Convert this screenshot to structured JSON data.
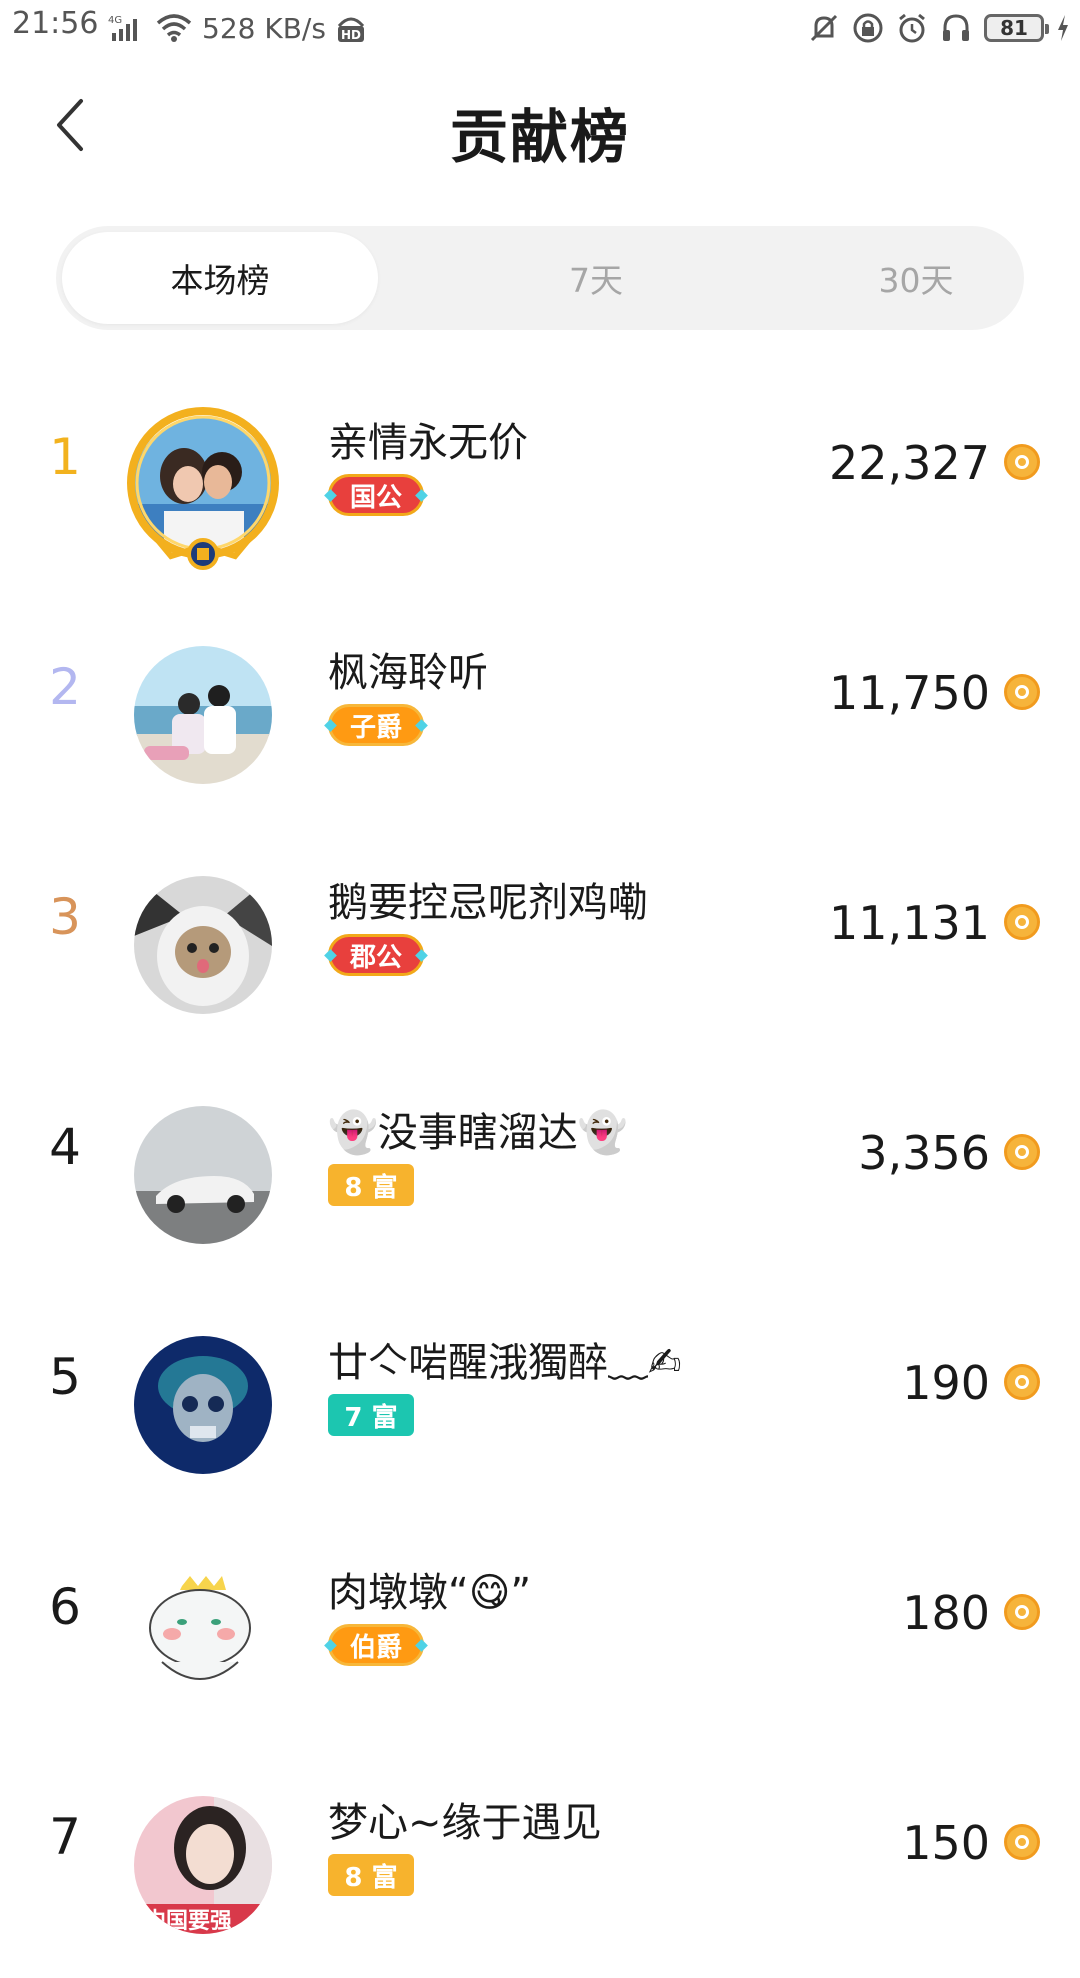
{
  "status_bar": {
    "time": "21:56",
    "network": "4G",
    "speed": "528 KB/s",
    "battery": "81",
    "icons": [
      "signal-icon",
      "wifi-icon",
      "hd-icon",
      "mute-icon",
      "lock-icon",
      "alarm-icon",
      "headphones-icon",
      "battery-icon",
      "charging-icon"
    ]
  },
  "header": {
    "title": "贡献榜",
    "back_icon": "chevron-left-icon"
  },
  "tabs": [
    {
      "label": "本场榜",
      "active": true
    },
    {
      "label": "7天",
      "active": false
    },
    {
      "label": "30天",
      "active": false
    }
  ],
  "colors": {
    "rank1": "#f2b21e",
    "rank2": "#b3b7f0",
    "rank3": "#d8945a",
    "coin": "#f6b43b",
    "noble_red": "#e8403d",
    "noble_orange": "#ff9a12",
    "wealth8": "#f7b32d",
    "wealth7": "#1cc6b0"
  },
  "list": [
    {
      "rank": "1",
      "name": "亲情永无价",
      "badge": "国公",
      "amount": "22,327"
    },
    {
      "rank": "2",
      "name": "枫海聆听",
      "badge": "子爵",
      "amount": "11,750"
    },
    {
      "rank": "3",
      "name": "鹅要控忌呢剂鸡嘞",
      "badge": "郡公",
      "amount": "11,131"
    },
    {
      "rank": "4",
      "name": "👻没事瞎溜达👻",
      "badge": "8 富",
      "amount": "3,356"
    },
    {
      "rank": "5",
      "name": "廿亽啱醒涐獨醉﹏✍",
      "badge": "7 富",
      "amount": "190"
    },
    {
      "rank": "6",
      "name": "肉墩墩“😋”",
      "badge": "伯爵",
      "amount": "180"
    },
    {
      "rank": "7",
      "name": "梦心~缘于遇见",
      "badge": "8 富",
      "amount": "150"
    }
  ],
  "avatar7_text": "中国要强"
}
